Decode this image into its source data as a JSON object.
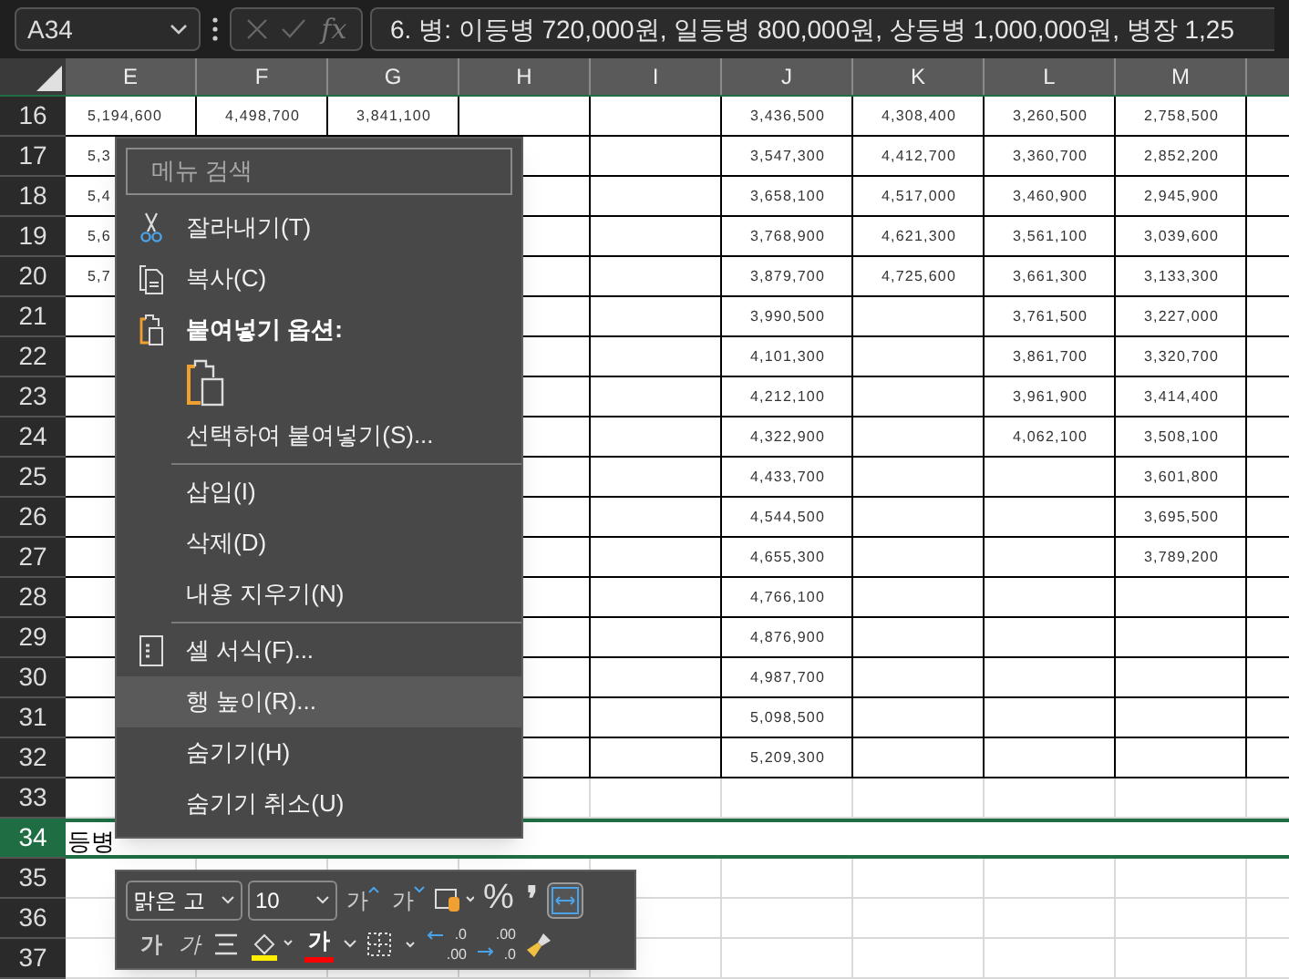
{
  "name_box": {
    "value": "A34"
  },
  "formula_bar": {
    "fx": "fx",
    "value": "6. 병: 이등병 720,000원, 일등병 800,000원, 상등병 1,000,000원, 병장 1,25"
  },
  "columns": [
    "E",
    "F",
    "G",
    "H",
    "I",
    "J",
    "K",
    "L",
    "M"
  ],
  "rows": [
    {
      "header": "16",
      "kind": "table",
      "selected": false,
      "cells": [
        "5,194,600",
        "4,498,700",
        "3,841,100",
        null,
        null,
        "3,436,500",
        "4,308,400",
        "3,260,500",
        "2,758,500"
      ]
    },
    {
      "header": "17",
      "kind": "table",
      "selected": false,
      "cells": [
        "5,3",
        null,
        null,
        null,
        null,
        "3,547,300",
        "4,412,700",
        "3,360,700",
        "2,852,200"
      ]
    },
    {
      "header": "18",
      "kind": "table",
      "selected": false,
      "cells": [
        "5,4",
        null,
        null,
        null,
        null,
        "3,658,100",
        "4,517,000",
        "3,460,900",
        "2,945,900"
      ]
    },
    {
      "header": "19",
      "kind": "table",
      "selected": false,
      "cells": [
        "5,6",
        null,
        null,
        null,
        null,
        "3,768,900",
        "4,621,300",
        "3,561,100",
        "3,039,600"
      ]
    },
    {
      "header": "20",
      "kind": "table",
      "selected": false,
      "cells": [
        "5,7",
        null,
        null,
        null,
        null,
        "3,879,700",
        "4,725,600",
        "3,661,300",
        "3,133,300"
      ]
    },
    {
      "header": "21",
      "kind": "table",
      "selected": false,
      "cells": [
        null,
        null,
        null,
        null,
        null,
        "3,990,500",
        null,
        "3,761,500",
        "3,227,000"
      ]
    },
    {
      "header": "22",
      "kind": "table",
      "selected": false,
      "cells": [
        null,
        null,
        null,
        null,
        null,
        "4,101,300",
        null,
        "3,861,700",
        "3,320,700"
      ]
    },
    {
      "header": "23",
      "kind": "table",
      "selected": false,
      "cells": [
        null,
        null,
        null,
        null,
        null,
        "4,212,100",
        null,
        "3,961,900",
        "3,414,400"
      ]
    },
    {
      "header": "24",
      "kind": "table",
      "selected": false,
      "cells": [
        null,
        null,
        null,
        null,
        null,
        "4,322,900",
        null,
        "4,062,100",
        "3,508,100"
      ]
    },
    {
      "header": "25",
      "kind": "table",
      "selected": false,
      "cells": [
        null,
        null,
        null,
        null,
        null,
        "4,433,700",
        null,
        null,
        "3,601,800"
      ]
    },
    {
      "header": "26",
      "kind": "table",
      "selected": false,
      "cells": [
        null,
        null,
        null,
        null,
        null,
        "4,544,500",
        null,
        null,
        "3,695,500"
      ]
    },
    {
      "header": "27",
      "kind": "table",
      "selected": false,
      "cells": [
        null,
        null,
        null,
        null,
        null,
        "4,655,300",
        null,
        null,
        "3,789,200"
      ]
    },
    {
      "header": "28",
      "kind": "table",
      "selected": false,
      "cells": [
        null,
        null,
        null,
        null,
        null,
        "4,766,100",
        null,
        null,
        null
      ]
    },
    {
      "header": "29",
      "kind": "table",
      "selected": false,
      "cells": [
        null,
        null,
        null,
        null,
        null,
        "4,876,900",
        null,
        null,
        null
      ]
    },
    {
      "header": "30",
      "kind": "table",
      "selected": false,
      "cells": [
        null,
        null,
        null,
        null,
        null,
        "4,987,700",
        null,
        null,
        null
      ]
    },
    {
      "header": "31",
      "kind": "table",
      "selected": false,
      "cells": [
        null,
        null,
        null,
        null,
        null,
        "5,098,500",
        null,
        null,
        null
      ]
    },
    {
      "header": "32",
      "kind": "table",
      "selected": false,
      "cells": [
        null,
        null,
        null,
        null,
        null,
        "5,209,300",
        null,
        null,
        null
      ]
    },
    {
      "header": "33",
      "kind": "blank",
      "selected": false
    },
    {
      "header": "34",
      "kind": "blank",
      "selected": true,
      "text": "등병"
    },
    {
      "header": "35",
      "kind": "blank",
      "selected": false
    },
    {
      "header": "36",
      "kind": "blank",
      "selected": false
    },
    {
      "header": "37",
      "kind": "blank",
      "selected": false
    }
  ],
  "context_menu": {
    "search": {
      "placeholder": "메뉴 검색"
    },
    "items": [
      {
        "kind": "cut",
        "label": "잘라내기(T)",
        "selected": false
      },
      {
        "kind": "copy",
        "label": "복사(C)",
        "selected": false
      },
      {
        "kind": "header",
        "label": "붙여넣기 옵션:"
      },
      {
        "kind": "paste-option"
      },
      {
        "kind": "item",
        "label": "선택하여 붙여넣기(S)...",
        "selected": false
      },
      {
        "kind": "separator"
      },
      {
        "kind": "item",
        "label": "삽입(I)",
        "selected": false
      },
      {
        "kind": "item",
        "label": "삭제(D)",
        "selected": false
      },
      {
        "kind": "item",
        "label": "내용 지우기(N)",
        "selected": false
      },
      {
        "kind": "separator"
      },
      {
        "kind": "format",
        "label": "셀 서식(F)...",
        "selected": false
      },
      {
        "kind": "item",
        "label": "행 높이(R)...",
        "selected": true
      },
      {
        "kind": "item",
        "label": "숨기기(H)",
        "selected": false
      },
      {
        "kind": "item",
        "label": "숨기기 취소(U)",
        "selected": false
      }
    ]
  },
  "mini_toolbar": {
    "font": "맑은 고",
    "size": "10",
    "grow": "가",
    "shrink": "가",
    "percent": "%",
    "comma": "❜",
    "bold": "가",
    "italic": "가",
    "font_color": "가",
    "increase_decimal": [
      ".0",
      ".00"
    ],
    "decrease_decimal": [
      ".00",
      ".0"
    ]
  }
}
